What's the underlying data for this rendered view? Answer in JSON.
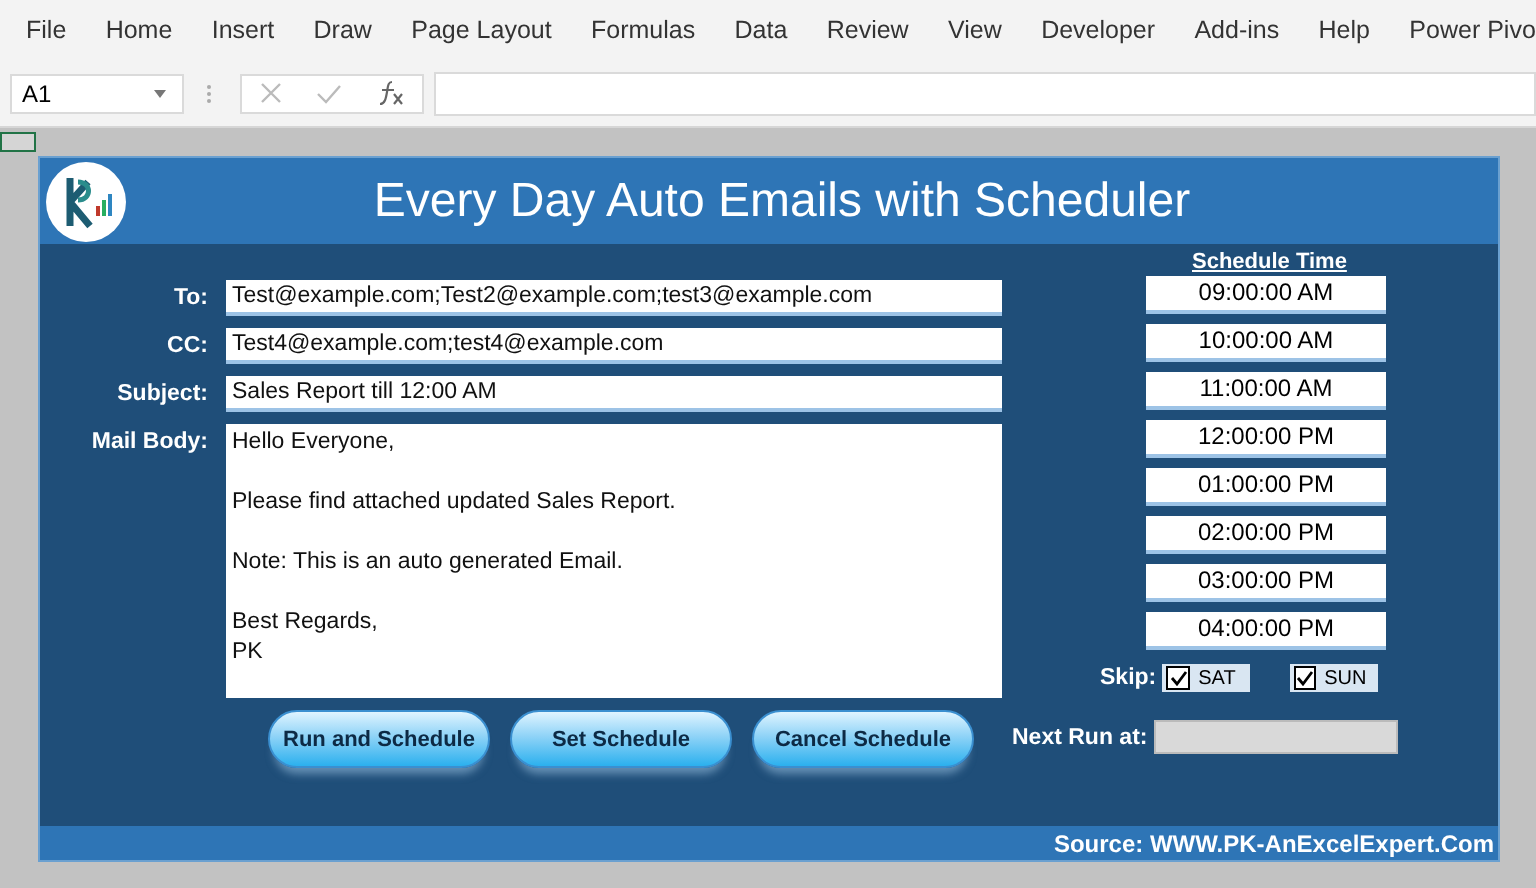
{
  "ribbon": {
    "tabs": [
      "File",
      "Home",
      "Insert",
      "Draw",
      "Page Layout",
      "Formulas",
      "Data",
      "Review",
      "View",
      "Developer",
      "Add-ins",
      "Help",
      "Power Pivo"
    ]
  },
  "formula_bar": {
    "name_box": "A1"
  },
  "form": {
    "title": "Every Day Auto Emails with Scheduler",
    "fields": [
      {
        "label": "To:",
        "value": "Test@example.com;Test2@example.com;test3@example.com"
      },
      {
        "label": "CC:",
        "value": "Test4@example.com;test4@example.com"
      },
      {
        "label": "Subject:",
        "value": "Sales Report till 12:00 AM"
      }
    ],
    "mail_body": {
      "label": "Mail Body:",
      "paragraphs": [
        [
          "Hello Everyone,"
        ],
        [
          "Please find attached updated Sales Report."
        ],
        [
          "Note: This is an auto generated Email."
        ],
        [
          "Best Regards,",
          "PK"
        ]
      ]
    },
    "buttons": [
      "Run and Schedule",
      "Set Schedule",
      "Cancel Schedule"
    ],
    "schedule": {
      "heading": "Schedule Time",
      "times": [
        "09:00:00 AM",
        "10:00:00 AM",
        "11:00:00 AM",
        "12:00:00 PM",
        "01:00:00 PM",
        "02:00:00 PM",
        "03:00:00 PM",
        "04:00:00 PM"
      ]
    },
    "skip": {
      "label": "Skip:",
      "days": [
        {
          "label": "SAT",
          "checked": true
        },
        {
          "label": "SUN",
          "checked": true
        }
      ]
    },
    "next_run": {
      "label": "Next Run at:"
    },
    "footer": "Source: WWW.PK-AnExcelExpert.Com"
  }
}
